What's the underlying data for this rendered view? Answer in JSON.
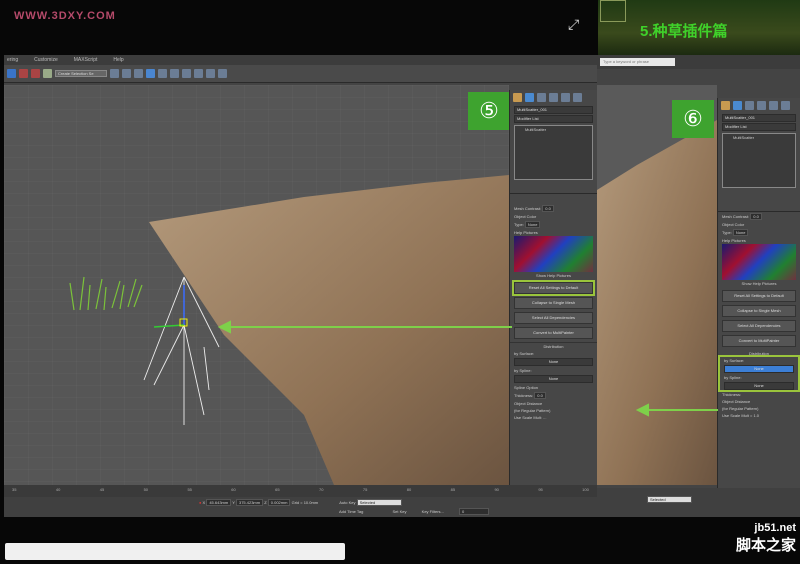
{
  "watermark_top": "WWW.3DXY.COM",
  "thumbnail_title": "5.种草插件篇",
  "watermark_bottom": {
    "site": "jb51.net",
    "name": "脚本之家"
  },
  "left_window": {
    "menu": [
      "ering",
      "Customize",
      "MAXScript",
      "Help"
    ],
    "toolbar_selection_set": "Create Selection Se",
    "step_number": "⑤",
    "panel": {
      "object_name": "MultiScatter_001",
      "modifier_list": "Modifier List",
      "stack_item": "MultiScatter",
      "mesh_contrast_label": "Mesh Contrast:",
      "mesh_contrast_value": "0.0",
      "object_color_label": "Object Color",
      "type_label": "Type:",
      "type_value": "None",
      "help_pictures_label": "Help Pictures",
      "show_help_pictures": "Show Help Pictures",
      "buttons": [
        "Reset All Settings to Default",
        "Collapse to Single Mesh",
        "Select All Dependencies",
        "Convert to MultiPainter"
      ],
      "distribution_header": "Distribution",
      "by_surface_label": "by Surface:",
      "by_surface_value": "None",
      "by_spline_label": "by Spline:",
      "by_spline_value": "None",
      "spline_option": "Spline Option",
      "thickness_label": "Thickness:",
      "thickness_value": "0.0",
      "object_distance": "Object Distance",
      "notes": [
        "(for Regular Pattern)",
        "Use Scale Mult: ..."
      ]
    },
    "timeline_ticks": [
      "35",
      "40",
      "45",
      "50",
      "55",
      "60",
      "65",
      "70",
      "75",
      "80",
      "85",
      "90",
      "95",
      "100"
    ],
    "status": {
      "x": "45.643mm",
      "y": "375.423mm",
      "z": "0.002mm",
      "grid": "Grid = 10.0mm",
      "add_time_tag": "Add Time Tag",
      "auto_key": "Auto Key",
      "selected": "Selected",
      "set_key": "Set Key",
      "key_filters": "Key Filters...",
      "frame": "0"
    }
  },
  "right_window": {
    "search_placeholder": "Type a keyword or phrase",
    "step_number": "⑥",
    "panel": {
      "object_name": "MultiScatter_001",
      "modifier_list": "Modifier List",
      "stack_item": "MultiScatter",
      "mesh_contrast_label": "Mesh Contrast:",
      "mesh_contrast_value": "0.0",
      "object_color_label": "Object Color",
      "type_label": "Type:",
      "type_value": "None",
      "help_pictures_label": "Help Pictures",
      "show_help_pictures": "Show Help Pictures",
      "buttons": [
        "Reset All Settings to Default",
        "Collapse to Single Mesh",
        "Select All Dependencies",
        "Convert to MultiPainter"
      ],
      "distribution_header": "Distribution",
      "by_surface_label": "by Surface:",
      "by_surface_value": "None",
      "by_spline_label": "by Spline:",
      "by_spline_value": "None",
      "thickness_label": "Thickness:",
      "object_distance": "Object Distance",
      "notes": [
        "(for Regular Pattern)",
        "Use Scale Mult = 1.0"
      ]
    },
    "status": {
      "selected": "Selected"
    }
  },
  "colors": {
    "highlight": "#9ac43c",
    "step_badge": "#3ea32f",
    "arrow": "#7ed04a",
    "selected_dropdown": "#3c7fd6"
  }
}
